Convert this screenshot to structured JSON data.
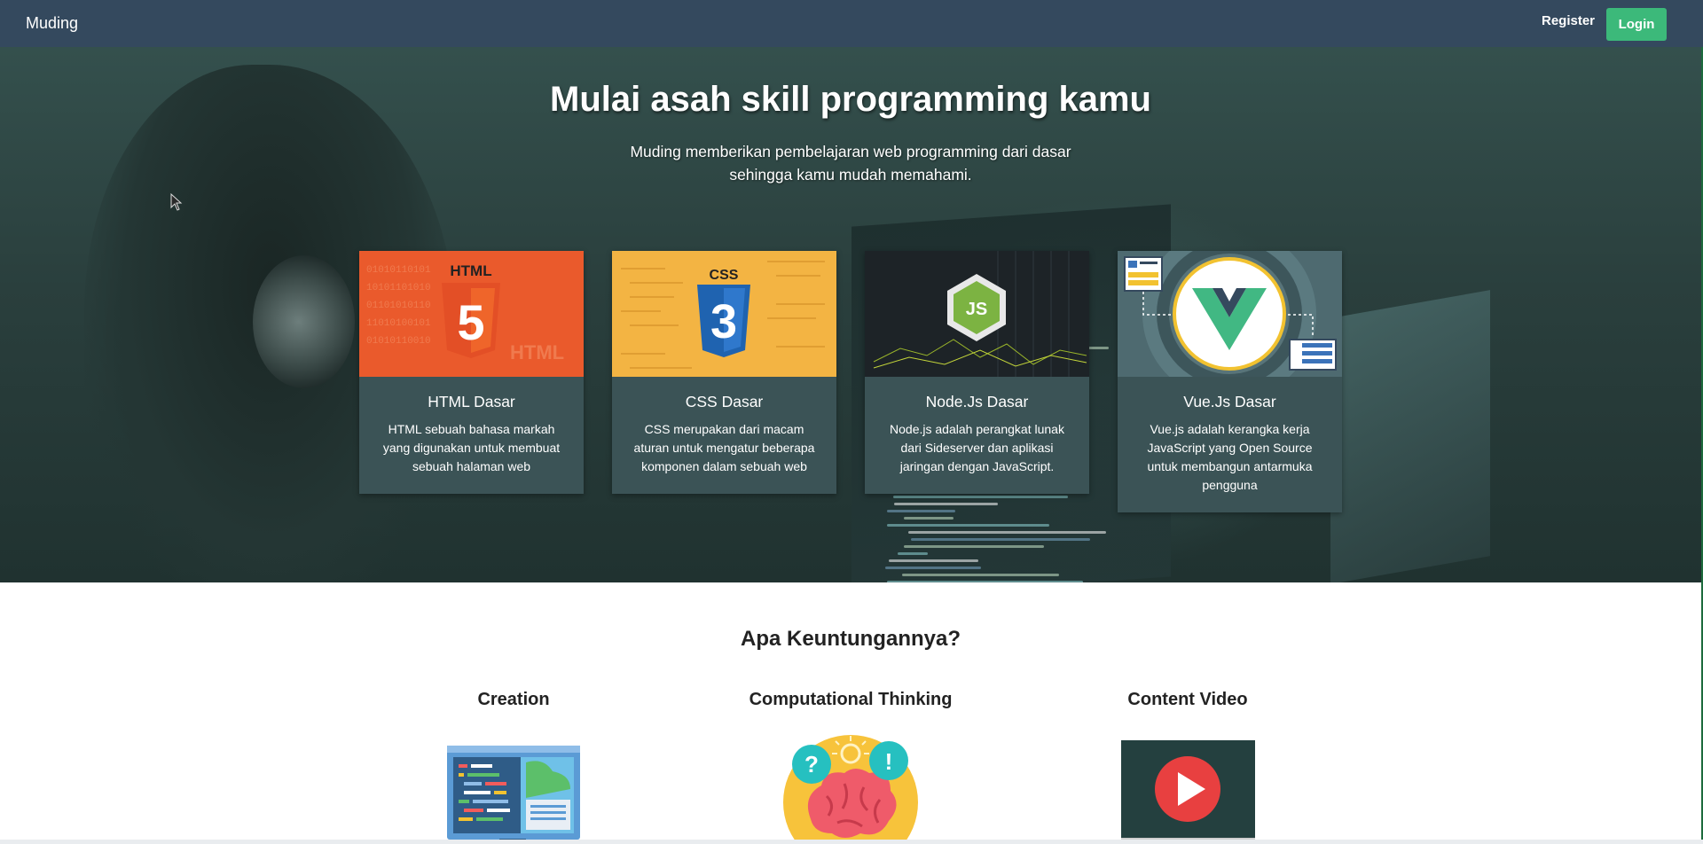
{
  "navbar": {
    "brand": "Muding",
    "register_label": "Register",
    "login_label": "Login"
  },
  "hero": {
    "title": "Mulai asah skill programming kamu",
    "subtitle": "Muding memberikan pembelajaran web programming dari dasar sehingga kamu mudah memahami."
  },
  "courses": [
    {
      "title": "HTML Dasar",
      "description": "HTML sebuah bahasa markah yang digunakan untuk membuat sebuah halaman web",
      "image_label": "HTML",
      "image_mark": "5"
    },
    {
      "title": "CSS Dasar",
      "description": "CSS merupakan dari macam aturan untuk mengatur beberapa komponen dalam sebuah web",
      "image_label": "CSS",
      "image_mark": "3"
    },
    {
      "title": "Node.Js Dasar",
      "description": "Node.js adalah perangkat lunak dari Sideserver dan aplikasi jaringan dengan JavaScript.",
      "image_label": "JS"
    },
    {
      "title": "Vue.Js Dasar",
      "description": "Vue.js adalah kerangka kerja JavaScript yang Open Source untuk membangun antarmuka pengguna"
    }
  ],
  "benefits": {
    "title": "Apa Keuntungannya?",
    "items": [
      {
        "title": "Creation"
      },
      {
        "title": "Computational Thinking"
      },
      {
        "title": "Content Video"
      }
    ]
  },
  "colors": {
    "navbar": "#34495e",
    "login_button": "#3cb97a",
    "card_body": "#3b5356",
    "html_orange": "#e44d26",
    "css_yellow": "#f3b443",
    "css_blue": "#1f63b0",
    "node_green": "#7cb342",
    "vue_green": "#41b883",
    "vue_dark": "#35495e",
    "play_red": "#e84040"
  }
}
